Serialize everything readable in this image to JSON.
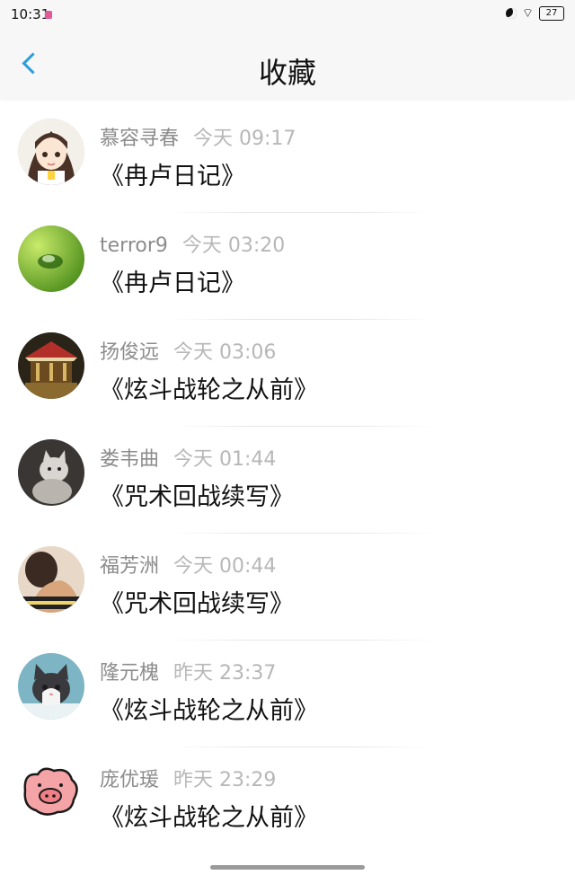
{
  "status_bar": {
    "time": "10:31",
    "battery": "27"
  },
  "header": {
    "title": "收藏"
  },
  "items": [
    {
      "user": "慕容寻春",
      "time": "今天 09:17",
      "title": "《冉卢日记》",
      "avatar": "anime-girl-avatar"
    },
    {
      "user": "terror9",
      "time": "今天 03:20",
      "title": "《冉卢日记》",
      "avatar": "water-drop-leaf-avatar"
    },
    {
      "user": "扬俊远",
      "time": "今天 03:06",
      "title": "《炫斗战轮之从前》",
      "avatar": "carousel-avatar"
    },
    {
      "user": "娄韦曲",
      "time": "今天 01:44",
      "title": "《咒术回战续写》",
      "avatar": "cat-photo-avatar"
    },
    {
      "user": "福芳洲",
      "time": "今天 00:44",
      "title": "《咒术回战续写》",
      "avatar": "person-back-avatar"
    },
    {
      "user": "隆元槐",
      "time": "昨天 23:37",
      "title": "《炫斗战轮之从前》",
      "avatar": "kitten-avatar"
    },
    {
      "user": "庞优瑗",
      "time": "昨天 23:29",
      "title": "《炫斗战轮之从前》",
      "avatar": "pink-pig-avatar"
    }
  ]
}
